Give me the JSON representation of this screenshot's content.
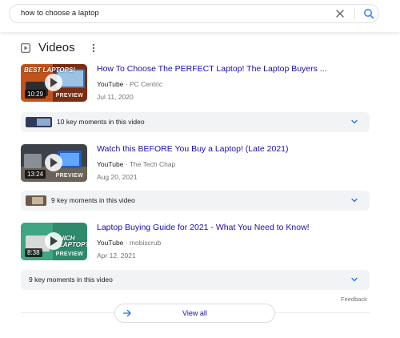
{
  "search": {
    "query": "how to choose a laptop"
  },
  "section": {
    "title": "Videos"
  },
  "results": [
    {
      "title": "How To Choose The PERFECT Laptop! The Laptop Buyers ...",
      "source": "YouTube",
      "channel": "· PC Centric",
      "date": "Jul 11, 2020",
      "duration": "10:29",
      "preview": "PREVIEW",
      "overlay": "BEST LAPTOPS!",
      "moments": "10 key moments in this video"
    },
    {
      "title": "Watch this BEFORE You Buy a Laptop! (Late 2021)",
      "source": "YouTube",
      "channel": "· The Tech Chap",
      "date": "Aug 20, 2021",
      "duration": "13:24",
      "preview": "PREVIEW",
      "overlay": "",
      "moments": "9 key moments in this video"
    },
    {
      "title": "Laptop Buying Guide for 2021 - What You Need to Know!",
      "source": "YouTube",
      "channel": "· mobiscrub",
      "date": "Apr 12, 2021",
      "duration": "8:38",
      "preview": "PREVIEW",
      "overlay": "HICH LAPTOP?",
      "moments": "9 key moments in this video"
    }
  ],
  "footer": {
    "feedback": "Feedback",
    "view_all": "View all"
  },
  "colors": {
    "link": "#1a0dab",
    "muted": "#70757a",
    "accent": "#4285f4",
    "chip_bg": "#f1f3f4"
  },
  "icons": [
    "close-icon",
    "search-icon",
    "video-icon",
    "more-vert-icon",
    "play-icon",
    "chevron-down-icon",
    "arrow-right-icon"
  ]
}
